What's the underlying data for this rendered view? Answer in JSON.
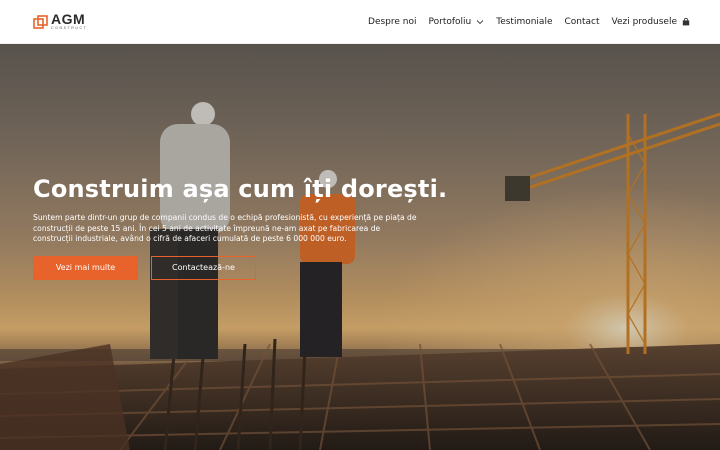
{
  "brand": {
    "name": "AGM",
    "tagline": "CONSTRUCT"
  },
  "nav": {
    "items": [
      {
        "label": "Despre noi"
      },
      {
        "label": "Portofoliu"
      },
      {
        "label": "Testimoniale"
      },
      {
        "label": "Contact"
      },
      {
        "label": "Vezi produsele"
      }
    ]
  },
  "hero": {
    "title": "Construim așa cum îți dorești.",
    "description": "Suntem parte dintr-un grup de companii condus de o echipă profesionistă, cu experiență pe piața de construcții de peste 15 ani. În cei 5 ani de activitate împreună ne-am axat pe fabricarea de construcții industriale, având o cifră de afaceri cumulată de peste 6 000 000 euro.",
    "primary_button": "Vezi mai multe",
    "secondary_button": "Contactează-ne"
  },
  "colors": {
    "accent": "#e8632b",
    "nav_bg": "#ffffff",
    "text_dark": "#222222"
  },
  "icons": {
    "logo": "agm-logo-icon",
    "dropdown": "chevron-down-icon",
    "products": "shopping-bag-icon"
  }
}
